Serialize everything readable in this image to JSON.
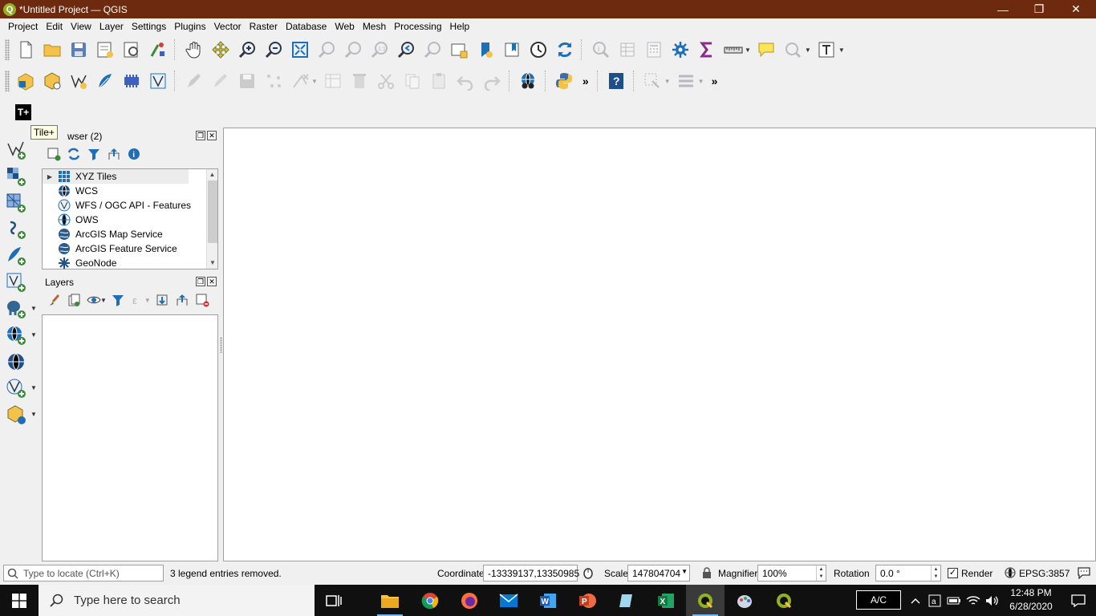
{
  "window": {
    "title": "*Untitled Project — QGIS",
    "logo_letter": "Q",
    "controls": {
      "minimize": "—",
      "restore": "❐",
      "close": "✕"
    }
  },
  "menu": [
    "Project",
    "Edit",
    "View",
    "Layer",
    "Settings",
    "Plugins",
    "Vector",
    "Raster",
    "Database",
    "Web",
    "Mesh",
    "Processing",
    "Help"
  ],
  "tooltip": "Tile+",
  "tile_plus_label": "T+",
  "browser_panel": {
    "title": "wser (2)",
    "items": [
      {
        "label": "XYZ Tiles"
      },
      {
        "label": "WCS"
      },
      {
        "label": "WFS / OGC API - Features"
      },
      {
        "label": "OWS"
      },
      {
        "label": "ArcGIS Map Service"
      },
      {
        "label": "ArcGIS Feature Service"
      },
      {
        "label": "GeoNode"
      }
    ]
  },
  "layers_panel": {
    "title": "Layers"
  },
  "statusbar": {
    "locate_placeholder": "Type to locate (Ctrl+K)",
    "message": "3 legend entries removed.",
    "coordinate_label": "Coordinate",
    "coordinate_value": "-13339137,13350985",
    "scale_label": "Scale",
    "scale_value": "147804704",
    "magnifier_label": "Magnifier",
    "magnifier_value": "100%",
    "rotation_label": "Rotation",
    "rotation_value": "0.0 °",
    "render_label": "Render",
    "render_checked": "✓",
    "crs": "EPSG:3857"
  },
  "taskbar": {
    "search_placeholder": "Type here to search",
    "tray_lang": "A/C",
    "time": "12:48 PM",
    "date": "6/28/2020"
  },
  "colors": {
    "titlebar": "#6d2a0e",
    "qgis_green": "#93b023",
    "accent_blue": "#1f6fb8"
  }
}
